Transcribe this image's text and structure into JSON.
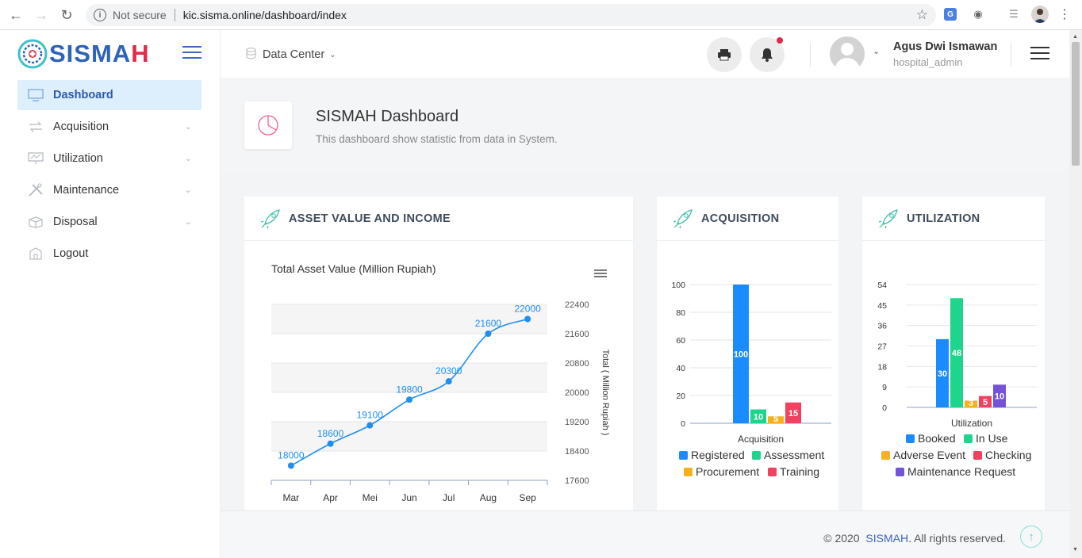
{
  "browser": {
    "security_label": "Not secure",
    "url": "kic.sisma.online/dashboard/index"
  },
  "app": {
    "logo_main": "SISMA",
    "logo_accent": "H"
  },
  "sidebar": {
    "items": [
      {
        "label": "Dashboard",
        "icon": "monitor-icon"
      },
      {
        "label": "Acquisition",
        "icon": "transfer-icon"
      },
      {
        "label": "Utilization",
        "icon": "presentation-icon"
      },
      {
        "label": "Maintenance",
        "icon": "tools-icon"
      },
      {
        "label": "Disposal",
        "icon": "box-icon"
      },
      {
        "label": "Logout",
        "icon": "logout-icon"
      }
    ]
  },
  "header": {
    "data_center_label": "Data Center",
    "user_name": "Agus Dwi Ismawan",
    "user_role": "hospital_admin"
  },
  "page": {
    "title": "SISMAH Dashboard",
    "subtitle": "This dashboard show statistic from data in System."
  },
  "cards": {
    "asset_title": "ASSET VALUE AND INCOME",
    "acquisition_title": "ACQUISITION",
    "utilization_title": "UTILIZATION"
  },
  "footer": {
    "copyright": "© 2020",
    "brand": "SISMAH",
    "rights": ". All rights reserved."
  },
  "colors": {
    "accent": "#3b64c4",
    "line": "#1f8ef1",
    "blue": "#1a8cff",
    "green": "#1dd68b",
    "orange": "#f8b01b",
    "red": "#f2405e",
    "purple": "#7453d6"
  },
  "chart_data": [
    {
      "type": "line",
      "title": "Total Asset Value (Million Rupiah)",
      "categories": [
        "Mar",
        "Apr",
        "Mei",
        "Jun",
        "Jul",
        "Aug",
        "Sep"
      ],
      "values": [
        18000,
        18600,
        19100,
        19800,
        20300,
        21600,
        22000
      ],
      "ylabel": "Total ( Million Rupiah )",
      "yticks": [
        17600,
        18400,
        19200,
        20000,
        20800,
        21600,
        22400
      ],
      "ylim": [
        17600,
        22400
      ],
      "y_axis_position": "right",
      "legend": "none"
    },
    {
      "type": "bar",
      "category": "Acquisition",
      "series": [
        {
          "name": "Registered",
          "values": [
            100
          ]
        },
        {
          "name": "Assessment",
          "values": [
            10
          ]
        },
        {
          "name": "Procurement",
          "values": [
            5
          ]
        },
        {
          "name": "Training",
          "values": [
            15
          ]
        }
      ],
      "yticks": [
        0,
        20,
        40,
        60,
        80,
        100
      ],
      "ylim": [
        0,
        100
      ],
      "legend": "bottom"
    },
    {
      "type": "bar",
      "category": "Utilization",
      "series": [
        {
          "name": "Booked",
          "values": [
            30
          ]
        },
        {
          "name": "In Use",
          "values": [
            48
          ]
        },
        {
          "name": "Adverse Event",
          "values": [
            3
          ]
        },
        {
          "name": "Checking",
          "values": [
            5
          ]
        },
        {
          "name": "Maintenance Request",
          "values": [
            10
          ]
        }
      ],
      "yticks": [
        0,
        9,
        18,
        27,
        36,
        45,
        54
      ],
      "ylim": [
        0,
        54
      ],
      "legend": "bottom"
    }
  ]
}
